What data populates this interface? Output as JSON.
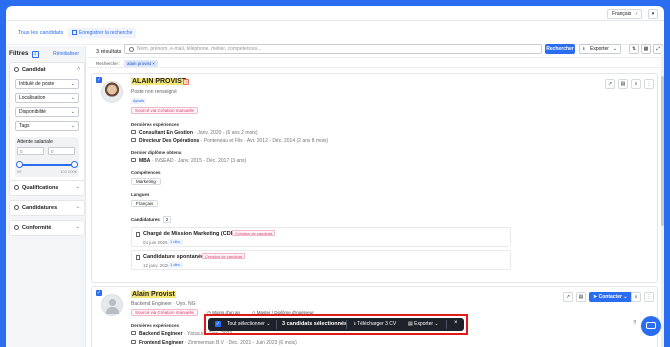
{
  "topbar": {
    "language": "Français"
  },
  "tabs": {
    "all_candidates": "Tous les candidats",
    "save_search": "Enregistrer la recherche"
  },
  "sidebar": {
    "title": "Filtres",
    "count": "1",
    "reset": "Réinitialiser",
    "candidate": {
      "title": "Candidat",
      "job_title": "Intitulé de poste",
      "location": "Localisation",
      "availability": "Disponibilité",
      "tags": "Tags",
      "salary_label": "Attente salariale",
      "salary_min_placeholder": "0",
      "salary_max_placeholder": "0",
      "salary_min": "0€",
      "salary_max": "100 000€"
    },
    "qualifications": "Qualifications",
    "applications": "Candidatures",
    "compliance": "Conformité"
  },
  "toolbar": {
    "results": "3 résultats",
    "search_placeholder": "Nom, prénom, e-mail, téléphone, métier, compétences...",
    "search_button": "Rechercher",
    "export_button": "Exporter"
  },
  "active_filter": {
    "label": "Recherche :",
    "chip": "alain provist"
  },
  "card1": {
    "name": "ALAIN PROVIST",
    "subtitle": "Poste non renseigné",
    "chip": "Ajouts",
    "source": "Sourcé via Création manuelle",
    "exp_label": "Dernières expériences",
    "exp1_title": "Consultant En Gestion",
    "exp1_rest": "· Janv. 2020 - (6 ans 2 mois)",
    "exp2_title": "Directeur Des Opérations",
    "exp2_rest": "· Ponteneau et Fils · Avr. 2012 - Déc. 2014 (2 ans 8 mois)",
    "degree_label": "Dernier diplôme obtenu",
    "degree_title": "MBA",
    "degree_rest": "· INSEAD · Janv. 2015 - Déc. 2017 (3 ans)",
    "skills_label": "Compétences",
    "skill1": "Marketing",
    "languages_label": "Langues",
    "language1": "Français",
    "applications_label": "Candidatures",
    "applications_count": "2",
    "app1_title": "Chargé de Mission Marketing (CDD)",
    "app1_tag": "Création de candidat",
    "app1_date": "04 juin 2025",
    "app1_chip": "1 déc.",
    "app2_title": "Candidature spontanée",
    "app2_tag": "Création de candidat",
    "app2_date": "12 janv. 2026",
    "app2_chip": "1 déc."
  },
  "card2": {
    "name": "Alain Provist",
    "subtitle": "Backend Engineer · Uyo, NG",
    "source": "Sourcé via Création manuelle",
    "availability": "Moins d'un an",
    "degree": "Master / Diplôme d'ingénieur",
    "contact_button": "Contacter",
    "exp_label": "Dernières expériences",
    "exp1_title": "Backend Engineer",
    "exp1_rest": "· Yarsa.io · Déc. 2023",
    "exp2_title": "Frontend Engineer",
    "exp2_rest": "· Zimmerman B.V · Déc. 2021 - Juin 2023 (6 mois)"
  },
  "bulk_bar": {
    "select_all": "Tout sélectionner",
    "count": "3 candidats sélectionnés",
    "download": "Télécharger 3 CV",
    "export": "Exporter"
  },
  "colors": {
    "primary": "#2a6df0",
    "highlight": "#f7e779",
    "bulk_bar": "#1e222a",
    "outline": "#e11919"
  }
}
